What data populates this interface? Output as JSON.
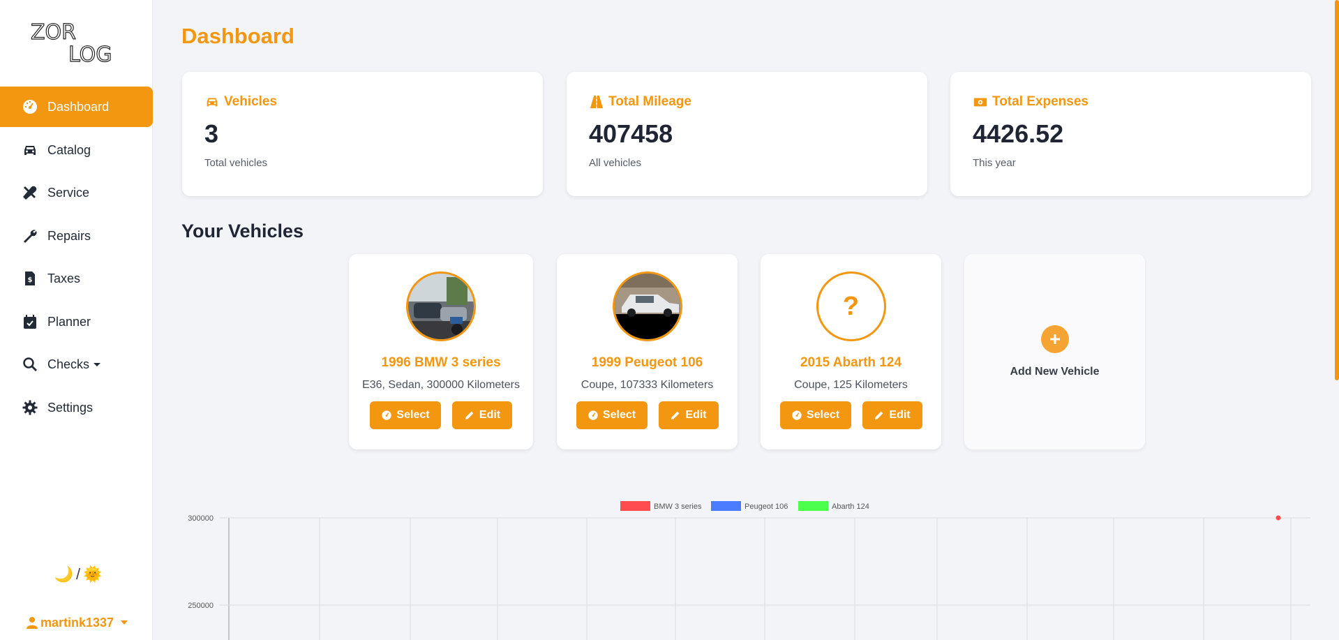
{
  "app": {
    "logo_text_top": "ZOR",
    "logo_text_bottom": "LOG"
  },
  "colors": {
    "accent": "#f39610",
    "bmw": "#ff4d4f",
    "peugeot": "#4b7bff",
    "abarth": "#4cff4c"
  },
  "sidebar": {
    "items": [
      {
        "label": "Dashboard",
        "icon": "dashboard-gauge-icon",
        "active": true
      },
      {
        "label": "Catalog",
        "icon": "car-icon"
      },
      {
        "label": "Service",
        "icon": "tools-icon"
      },
      {
        "label": "Repairs",
        "icon": "wrench-icon"
      },
      {
        "label": "Taxes",
        "icon": "invoice-dollar-icon"
      },
      {
        "label": "Planner",
        "icon": "calendar-check-icon"
      },
      {
        "label": "Checks",
        "icon": "search-icon"
      },
      {
        "label": "Settings",
        "icon": "gear-icon"
      }
    ],
    "theme_toggle": {
      "moon": "🌙",
      "separator": "/",
      "sun": "🌞"
    },
    "user": "martink1337"
  },
  "page": {
    "title": "Dashboard",
    "section_title": "Your Vehicles"
  },
  "stats": [
    {
      "label": "Vehicles",
      "value": "3",
      "sub": "Total vehicles",
      "icon": "car-icon"
    },
    {
      "label": "Total Mileage",
      "value": "407458",
      "sub": "All vehicles",
      "icon": "road-icon"
    },
    {
      "label": "Total Expenses",
      "value": "4426.52",
      "sub": "This year",
      "icon": "money-bill-icon"
    }
  ],
  "vehicles": [
    {
      "name": "1996 BMW 3 series",
      "desc": "E36, Sedan, 300000 Kilometers",
      "select": "Select",
      "edit": "Edit",
      "photo": "bmw-photo"
    },
    {
      "name": "1999 Peugeot 106",
      "desc": "Coupe, 107333 Kilometers",
      "select": "Select",
      "edit": "Edit",
      "photo": "peugeot-photo"
    },
    {
      "name": "2015 Abarth 124",
      "desc": "Coupe, 125 Kilometers",
      "select": "Select",
      "edit": "Edit",
      "photo": "placeholder",
      "placeholder": "?"
    }
  ],
  "add_vehicle": {
    "label": "Add New Vehicle"
  },
  "chart_data": {
    "type": "line",
    "series": [
      {
        "name": "BMW 3 series",
        "color": "#ff4d4f",
        "points": [
          {
            "y": 300000
          }
        ]
      },
      {
        "name": "Peugeot 106",
        "color": "#4b7bff",
        "points": []
      },
      {
        "name": "Abarth 124",
        "color": "#4cff4c",
        "points": []
      }
    ],
    "y_ticks": [
      "300000",
      "250000"
    ],
    "grid": true,
    "legend_position": "top"
  }
}
